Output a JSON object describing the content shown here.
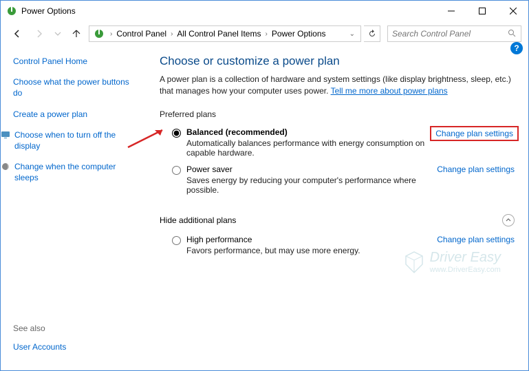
{
  "window": {
    "title": "Power Options"
  },
  "breadcrumb": {
    "items": [
      "Control Panel",
      "All Control Panel Items",
      "Power Options"
    ]
  },
  "search": {
    "placeholder": "Search Control Panel"
  },
  "sidebar": {
    "home": "Control Panel Home",
    "links": {
      "chooseButtons": "Choose what the power buttons do",
      "createPlan": "Create a power plan",
      "turnOffDisplay": "Choose when to turn off the display",
      "computerSleeps": "Change when the computer sleeps"
    },
    "seeAlsoLabel": "See also",
    "userAccounts": "User Accounts"
  },
  "main": {
    "heading": "Choose or customize a power plan",
    "description": "A power plan is a collection of hardware and system settings (like display brightness, sleep, etc.) that manages how your computer uses power. ",
    "tellMeMore": "Tell me more about power plans",
    "preferredLabel": "Preferred plans",
    "hideLabel": "Hide additional plans",
    "changeSettings": "Change plan settings",
    "plans": {
      "balanced": {
        "name": "Balanced (recommended)",
        "desc": "Automatically balances performance with energy consumption on capable hardware."
      },
      "powerSaver": {
        "name": "Power saver",
        "desc": "Saves energy by reducing your computer's performance where possible."
      },
      "highPerf": {
        "name": "High performance",
        "desc": "Favors performance, but may use more energy."
      }
    }
  },
  "watermark": {
    "line1": "Driver Easy",
    "line2": "www.DriverEasy.com"
  }
}
